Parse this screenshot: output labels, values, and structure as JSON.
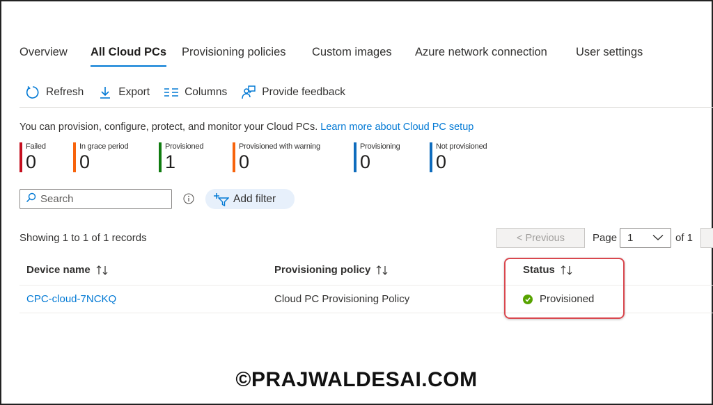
{
  "tabs": [
    "Overview",
    "All Cloud PCs",
    "Provisioning policies",
    "Custom images",
    "Azure network connection",
    "User settings"
  ],
  "toolbar": {
    "refresh": "Refresh",
    "export": "Export",
    "columns": "Columns",
    "feedback": "Provide feedback"
  },
  "intro": {
    "text": "You can provision, configure, protect, and monitor your Cloud PCs. ",
    "link": "Learn more about Cloud PC setup"
  },
  "tiles": [
    {
      "label": "Failed",
      "count": "0",
      "color": "#c50f1f"
    },
    {
      "label": "In grace period",
      "count": "0",
      "color": "#f7630c"
    },
    {
      "label": "Provisioned",
      "count": "1",
      "color": "#107c10"
    },
    {
      "label": "Provisioned with warning",
      "count": "0",
      "color": "#f7630c"
    },
    {
      "label": "Provisioning",
      "count": "0",
      "color": "#0f6cbd"
    },
    {
      "label": "Not provisioned",
      "count": "0",
      "color": "#0f6cbd"
    }
  ],
  "search": {
    "placeholder": "Search"
  },
  "filter": {
    "label": "Add filter"
  },
  "paging": {
    "records": "Showing 1 to 1 of 1 records",
    "previous": "< Previous",
    "page_label": "Page",
    "page_value": "1",
    "of_label": "of 1"
  },
  "table": {
    "headers": [
      "Device name",
      "Provisioning policy",
      "Status"
    ],
    "rows": [
      {
        "device": "CPC-cloud-7NCKQ",
        "policy": "Cloud PC Provisioning Policy",
        "status": "Provisioned"
      }
    ]
  },
  "watermark": "©PRAJWALDESAI.COM",
  "colors": {
    "accent": "#0078d4",
    "status_ok": "#57a300",
    "highlight": "#d9474e"
  }
}
